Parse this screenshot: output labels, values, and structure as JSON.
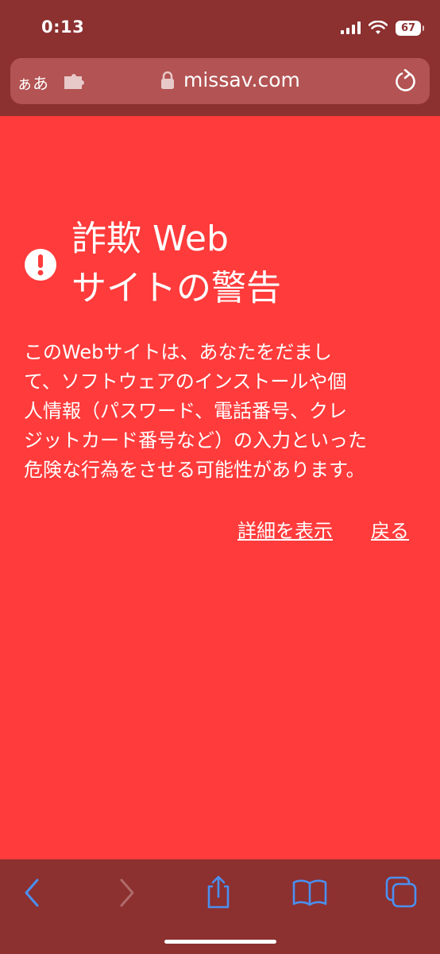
{
  "status_bar": {
    "time": "0:13",
    "battery": "67",
    "icons": [
      "signal-icon",
      "wifi-icon",
      "battery-icon"
    ]
  },
  "url_bar": {
    "reader_label": "ぁあ",
    "url": "missav.com",
    "icons": [
      "extension-icon",
      "lock-icon",
      "reload-icon"
    ]
  },
  "warning": {
    "title_line1": "詐欺 Web",
    "title_line2": "サイトの警告",
    "body_lines": [
      "このWebサイトは、あなたをだまし",
      "て、ソフトウェアのインストールや個",
      "人情報（パスワード、電話番号、クレ",
      "ジットカード番号など）の入力といった",
      "危険な行為をさせる可能性があります。"
    ],
    "show_details_label": "詳細を表示",
    "go_back_label": "戻る",
    "icon": "exclamation-circle-icon"
  },
  "toolbar": {
    "icons": [
      "back-icon",
      "forward-icon",
      "share-icon",
      "bookmarks-icon",
      "tabs-icon"
    ],
    "accent_color": "#4A90F0",
    "disabled_color": "#B06A6A"
  },
  "colors": {
    "page_background": "#FF3B3B",
    "chrome_background": "#8C3030",
    "url_bar_background": "#B35353",
    "text": "#FFFFFF"
  }
}
